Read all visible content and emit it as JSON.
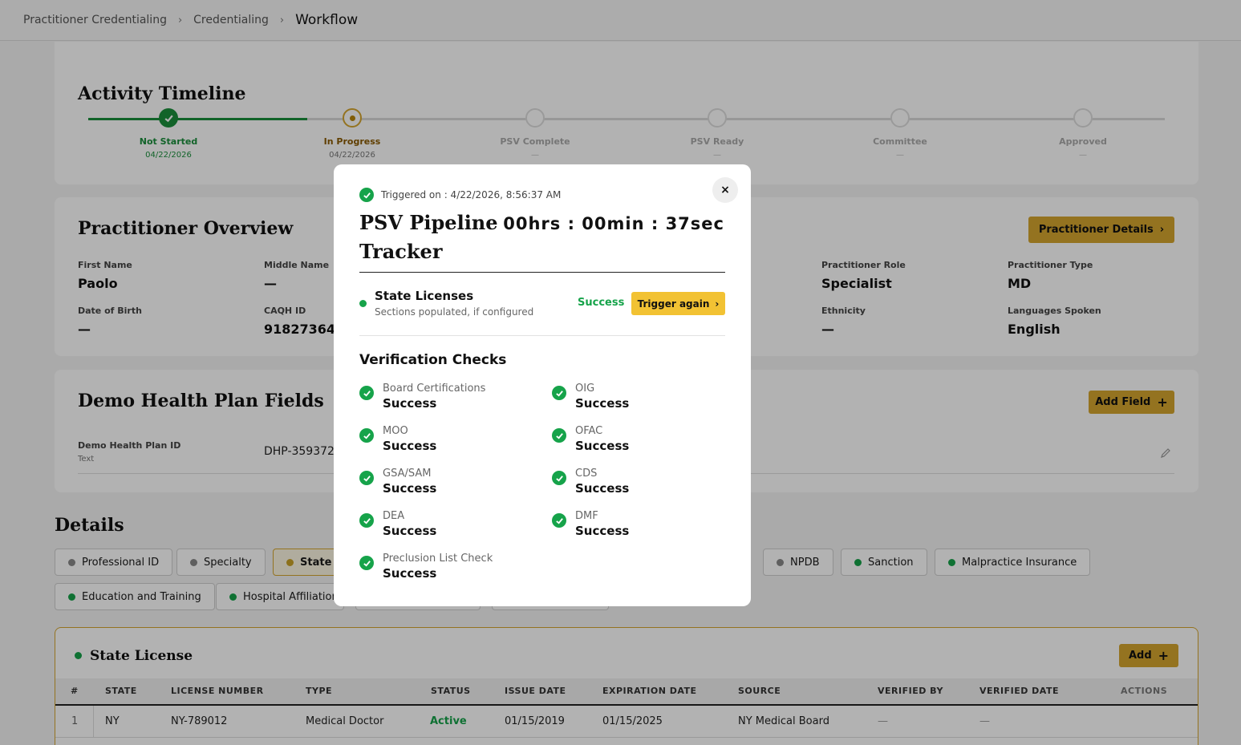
{
  "breadcrumb": [
    "Practitioner Credentialing",
    "Credentialing",
    "Workflow"
  ],
  "timeline": {
    "title": "Activity Timeline",
    "steps": [
      {
        "label": "Not Started",
        "date": "04/22/2026"
      },
      {
        "label": "In Progress",
        "date": "04/22/2026"
      },
      {
        "label": "PSV Complete",
        "date": "—"
      },
      {
        "label": "PSV Ready",
        "date": "—"
      },
      {
        "label": "Committee",
        "date": "—"
      },
      {
        "label": "Approved",
        "date": "—"
      }
    ]
  },
  "overview": {
    "title": "Practitioner Overview",
    "details_button": "Practitioner Details",
    "fields": [
      {
        "label": "First Name",
        "value": "Paolo"
      },
      {
        "label": "Middle Name",
        "value": "—"
      },
      {
        "label": "Practitioner Role",
        "value": "Specialist"
      },
      {
        "label": "Practitioner Type",
        "value": "MD"
      },
      {
        "label": "Date of Birth",
        "value": "—"
      },
      {
        "label": "CAQH ID",
        "value": "918273645"
      },
      {
        "label": "Ethnicity",
        "value": "—"
      },
      {
        "label": "Languages Spoken",
        "value": "English"
      }
    ]
  },
  "plan_fields": {
    "title": "Demo Health Plan Fields",
    "add_button": "Add Field",
    "field_label": "Demo Health Plan ID",
    "field_type": "Text",
    "field_value": "DHP-359372"
  },
  "details": {
    "title": "Details",
    "tabs": [
      {
        "label": "Professional ID",
        "color": "#888888"
      },
      {
        "label": "Specialty",
        "color": "#888888"
      },
      {
        "label": "State L",
        "color": "#c9a227"
      },
      {
        "label": "NPDB",
        "color": "#888888"
      },
      {
        "label": "Sanction",
        "color": "#16a34a"
      },
      {
        "label": "Malpractice Insurance",
        "color": "#16a34a"
      },
      {
        "label": "Education and Training",
        "color": "#16a34a"
      },
      {
        "label": "Hospital Affiliation",
        "color": "#16a34a"
      }
    ]
  },
  "license": {
    "title": "State License",
    "add_button": "Add",
    "columns": [
      "#",
      "STATE",
      "LICENSE NUMBER",
      "TYPE",
      "STATUS",
      "ISSUE DATE",
      "EXPIRATION DATE",
      "SOURCE",
      "VERIFIED BY",
      "VERIFIED DATE",
      "ACTIONS"
    ],
    "rows": [
      [
        "1",
        "NY",
        "NY-789012",
        "Medical Doctor",
        "Active",
        "01/15/2019",
        "01/15/2025",
        "NY Medical Board",
        "—",
        "—",
        ""
      ]
    ]
  },
  "modal": {
    "triggered": "Triggered on : 4/22/2026, 8:56:37 AM",
    "title_line1": "PSV Pipeline",
    "title_line2": "Tracker",
    "timer": "00hrs : 00min : 37sec",
    "close": "×",
    "pipeline": {
      "name": "State Licenses",
      "subtitle": "Sections populated, if configured",
      "status": "Success",
      "trigger_button": "Trigger again"
    },
    "checks_title": "Verification Checks",
    "checks": [
      {
        "name": "Board Certifications",
        "status": "Success"
      },
      {
        "name": "OIG",
        "status": "Success"
      },
      {
        "name": "MOO",
        "status": "Success"
      },
      {
        "name": "OFAC",
        "status": "Success"
      },
      {
        "name": "GSA/SAM",
        "status": "Success"
      },
      {
        "name": "CDS",
        "status": "Success"
      },
      {
        "name": "DEA",
        "status": "Success"
      },
      {
        "name": "DMF",
        "status": "Success"
      },
      {
        "name": "Preclusion List Check",
        "status": "Success"
      }
    ]
  },
  "colors": {
    "accent_gold": "#d4a52f",
    "trigger_yellow": "#f2c233",
    "success_green": "#16a34a"
  }
}
